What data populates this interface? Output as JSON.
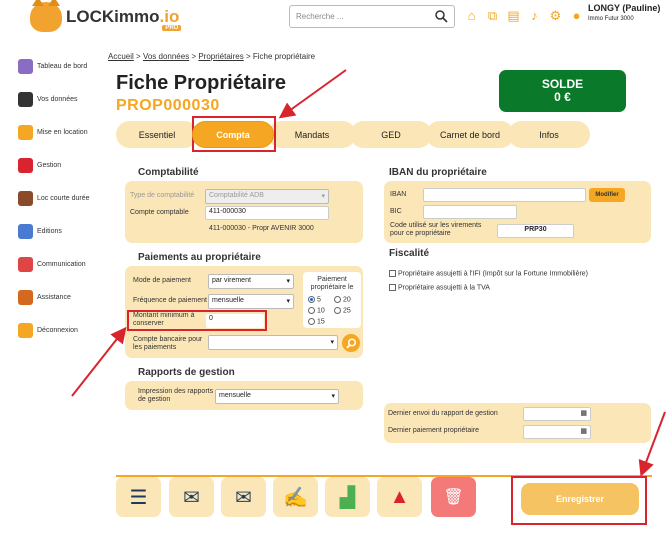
{
  "header": {
    "logo_text": "LOCKimmo",
    "logo_io": ".io",
    "logo_badge": "PRO",
    "search_placeholder": "Recherche ...",
    "user_name": "LONGY (Pauline)",
    "user_agency": "Immo Futur 3000"
  },
  "sidebar": {
    "items": [
      {
        "label": "Tableau de bord",
        "icon": "dashboard-icon",
        "color": "#8a6cc4"
      },
      {
        "label": "Vos données",
        "icon": "person-icon",
        "color": "#333"
      },
      {
        "label": "Mise en location",
        "icon": "key-icon",
        "color": "#f5a623"
      },
      {
        "label": "Gestion",
        "icon": "management-icon",
        "color": "#d9232d"
      },
      {
        "label": "Loc courte durée",
        "icon": "suitcase-icon",
        "color": "#8b4b2b"
      },
      {
        "label": "Editions",
        "icon": "edit-icon",
        "color": "#4a7bd0"
      },
      {
        "label": "Communication",
        "icon": "chat-icon",
        "color": "#e04545"
      },
      {
        "label": "Assistance",
        "icon": "support-icon",
        "color": "#d2691e"
      },
      {
        "label": "Déconnexion",
        "icon": "logout-icon",
        "color": "#f5a623"
      }
    ]
  },
  "breadcrumb": {
    "home": "Accueil",
    "data": "Vos données",
    "owners": "Propriétaires",
    "current": "Fiche propriétaire",
    "sep": ">"
  },
  "page": {
    "title": "Fiche Propriétaire",
    "code": "PROP000030"
  },
  "solde": {
    "label": "SOLDE",
    "value": "0 €"
  },
  "tabs": [
    "Essentiel",
    "Compta",
    "Mandats",
    "GED",
    "Carnet de bord",
    "Infos"
  ],
  "comptabilite": {
    "title": "Comptabilité",
    "type_label": "Type de comptabilité",
    "type_value": "Comptabilité ADB",
    "account_label": "Compte comptable",
    "account_value": "411-000030",
    "account_desc": "411-000030 - Propr AVENIR 3000"
  },
  "iban": {
    "title": "IBAN du propriétaire",
    "iban_label": "IBAN",
    "iban_value": "",
    "modify_label": "Modifier",
    "bic_label": "BIC",
    "bic_value": "",
    "code_label": "Code utilisé sur les virements pour ce propriétaire",
    "code_value": "PRP30"
  },
  "paiements": {
    "title": "Paiements au propriétaire",
    "mode_label": "Mode de paiement",
    "mode_value": "par virement",
    "freq_label": "Fréquence de paiement",
    "freq_value": "mensuelle",
    "min_label": "Montant minimum à conserver",
    "min_value": "0",
    "bank_label": "Compte bancaire pour les paiements",
    "bank_value": "",
    "day_title": "Paiement propriétaire le",
    "days": [
      "5",
      "20",
      "10",
      "25",
      "15"
    ],
    "selected_day": "5"
  },
  "fiscalite": {
    "title": "Fiscalité",
    "ifi_label": "Propriétaire assujetti à l'IFI (Impôt sur la Fortune Immobilière)",
    "tva_label": "Propriétaire assujetti à la TVA"
  },
  "rapports": {
    "title": "Rapports de gestion",
    "print_label": "Impression des rapports de gestion",
    "print_value": "mensuelle",
    "last_report_label": "Dernier envoi du rapport de gestion",
    "last_payment_label": "Dernier paiement propriétaire"
  },
  "footer": {
    "save_label": "Enregistrer"
  }
}
